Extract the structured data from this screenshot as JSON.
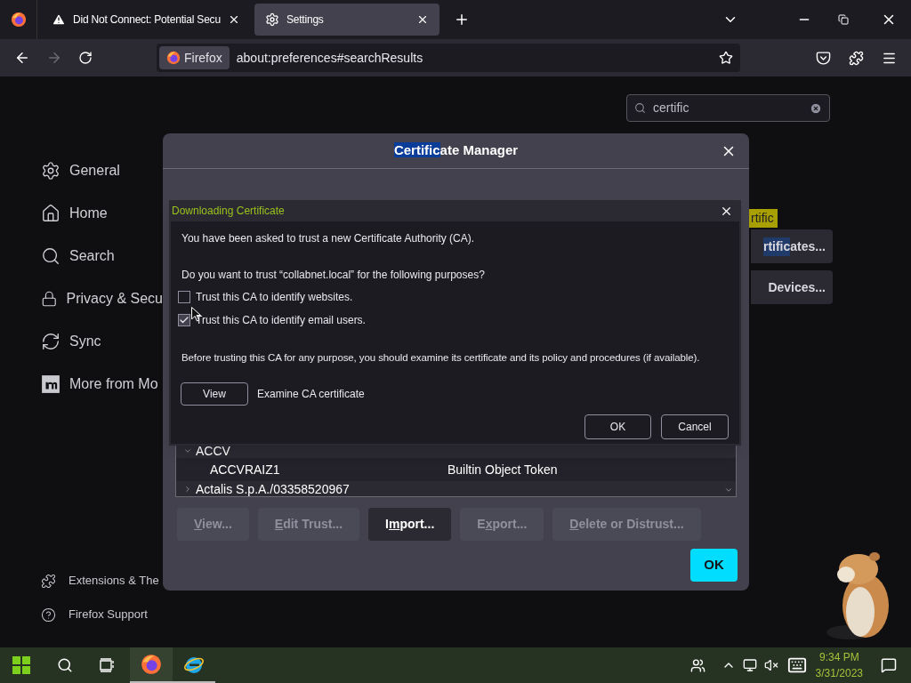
{
  "browser": {
    "tabs": [
      {
        "title": "Did Not Connect: Potential Secu",
        "selected": false,
        "kind": "warning"
      },
      {
        "title": "Settings",
        "selected": true,
        "kind": "settings"
      }
    ],
    "identity": "Firefox",
    "url": "about:preferences#searchResults"
  },
  "settings": {
    "search": {
      "value": "certific"
    },
    "sidebar": [
      {
        "label": "General",
        "kind": "general"
      },
      {
        "label": "Home",
        "kind": "home"
      },
      {
        "label": "Search",
        "kind": "search"
      },
      {
        "label": "Privacy & Secu",
        "kind": "privacy"
      },
      {
        "label": "Sync",
        "kind": "sync"
      },
      {
        "label": "More from Mo",
        "kind": "more"
      }
    ],
    "sidebar_footer": [
      {
        "label": "Extensions & The",
        "kind": "extensions"
      },
      {
        "label": "Firefox Support",
        "kind": "support"
      }
    ],
    "search_tooltip": "rtific",
    "buttons": [
      {
        "highlight": "rtific",
        "label": "ates..."
      },
      {
        "label": "Devices..."
      }
    ]
  },
  "certificate_manager": {
    "title_highlight": "Certific",
    "title_rest": "ate Manager",
    "tree": [
      {
        "label": "ACCV",
        "expanded": true,
        "children": [
          {
            "name": "ACCVRAIZ1",
            "token": "Builtin Object Token"
          }
        ]
      },
      {
        "label": "Actalis S.p.A./03358520967",
        "expanded": false
      }
    ],
    "buttons": [
      {
        "key": "V",
        "post": "iew...",
        "disabled": true
      },
      {
        "key": "E",
        "post": "dit Trust...",
        "disabled": true
      },
      {
        "pre": "I",
        "key": "m",
        "post": "port...",
        "disabled": false
      },
      {
        "pre": "E",
        "key": "x",
        "post": "port...",
        "disabled": true
      },
      {
        "key": "D",
        "post": "elete or Distrust...",
        "disabled": true
      }
    ],
    "ok": "OK"
  },
  "download_dialog": {
    "title": "Downloading Certificate",
    "intro": "You have been asked to trust a new Certificate Authority (CA).",
    "question": "Do you want to trust “collabnet.local” for the following purposes?",
    "options": [
      {
        "label": "Trust this CA to identify websites.",
        "checked": false
      },
      {
        "label": "Trust this CA to identify email users.",
        "checked": true
      }
    ],
    "advice": "Before trusting this CA for any purpose, you should examine its certificate and its policy and procedures (if available).",
    "view_button": "View",
    "view_label": "Examine CA certificate",
    "ok": "OK",
    "cancel": "Cancel"
  },
  "taskbar": {
    "time": "9:34 PM",
    "date": "3/31/2023"
  }
}
